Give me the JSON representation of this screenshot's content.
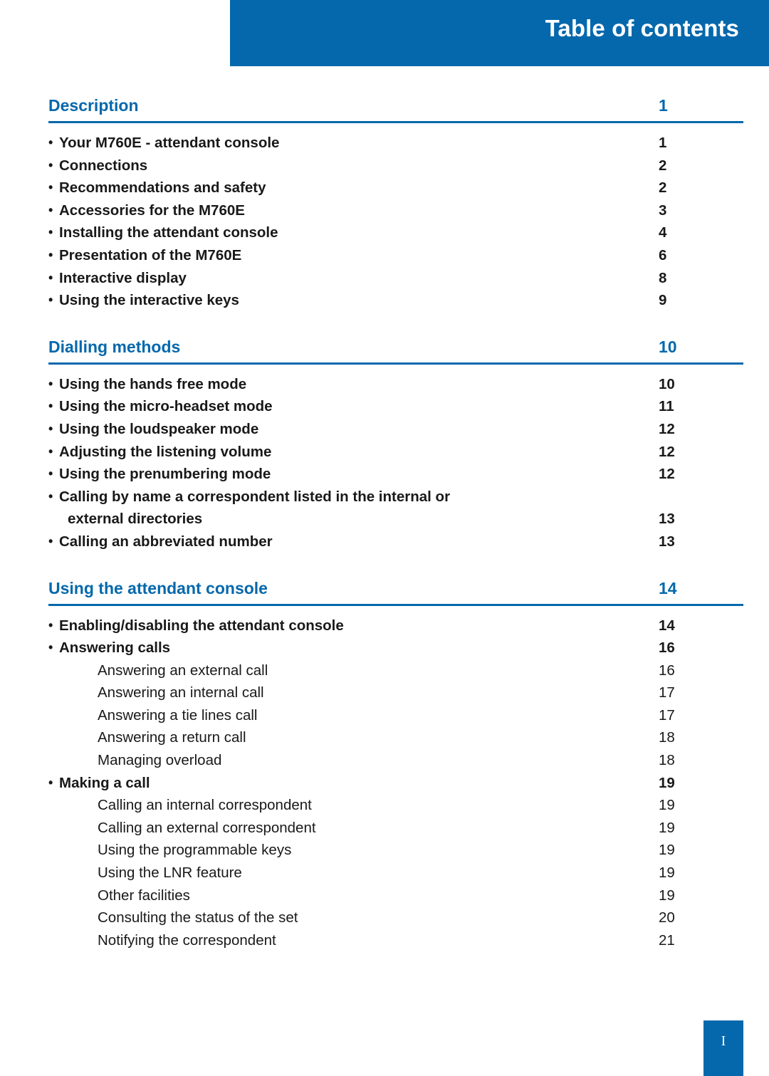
{
  "header": {
    "title": "Table of contents",
    "bar_color": "#0568ac"
  },
  "footer": {
    "page_marker": "I"
  },
  "sections": [
    {
      "title": "Description",
      "page": "1",
      "entries": [
        {
          "level": 1,
          "label": "Your M760E - attendant console",
          "page": "1"
        },
        {
          "level": 1,
          "label": "Connections",
          "page": "2"
        },
        {
          "level": 1,
          "label": "Recommendations and safety",
          "page": "2"
        },
        {
          "level": 1,
          "label": "Accessories for the M760E",
          "page": "3"
        },
        {
          "level": 1,
          "label": "Installing the attendant console",
          "page": "4"
        },
        {
          "level": 1,
          "label": "Presentation of the M760E",
          "page": "6"
        },
        {
          "level": 1,
          "label": "Interactive display",
          "page": "8"
        },
        {
          "level": 1,
          "label": "Using the interactive keys",
          "page": "9"
        }
      ]
    },
    {
      "title": "Dialling methods",
      "page": "10",
      "entries": [
        {
          "level": 1,
          "label": "Using the hands free mode",
          "page": "10"
        },
        {
          "level": 1,
          "label": "Using the micro-headset mode",
          "page": "11"
        },
        {
          "level": 1,
          "label": "Using the loudspeaker mode",
          "page": "12"
        },
        {
          "level": 1,
          "label": "Adjusting the listening volume",
          "page": "12"
        },
        {
          "level": 1,
          "label": "Using the prenumbering mode",
          "page": "12"
        },
        {
          "level": 1,
          "label": "Calling by name a correspondent listed in the internal or",
          "page": ""
        },
        {
          "level": "1cont",
          "label": "external directories",
          "page": "13"
        },
        {
          "level": 1,
          "label": "Calling an abbreviated number",
          "page": "13"
        }
      ]
    },
    {
      "title": "Using the attendant console",
      "page": "14",
      "entries": [
        {
          "level": 1,
          "label": "Enabling/disabling the attendant console",
          "page": "14"
        },
        {
          "level": 1,
          "label": "Answering calls",
          "page": "16"
        },
        {
          "level": 2,
          "label": "Answering an external call",
          "page": "16"
        },
        {
          "level": 2,
          "label": "Answering an internal call",
          "page": "17"
        },
        {
          "level": 2,
          "label": "Answering a tie lines call",
          "page": "17"
        },
        {
          "level": 2,
          "label": "Answering a return call",
          "page": "18"
        },
        {
          "level": 2,
          "label": "Managing overload",
          "page": "18"
        },
        {
          "level": 1,
          "label": "Making a call",
          "page": "19"
        },
        {
          "level": 2,
          "label": "Calling an internal correspondent",
          "page": "19"
        },
        {
          "level": 2,
          "label": "Calling an external correspondent",
          "page": "19"
        },
        {
          "level": 2,
          "label": "Using the programmable keys",
          "page": "19"
        },
        {
          "level": 2,
          "label": "Using the LNR feature",
          "page": "19"
        },
        {
          "level": 2,
          "label": "Other facilities",
          "page": "19"
        },
        {
          "level": 2,
          "label": "Consulting the status of the set",
          "page": "20"
        },
        {
          "level": 2,
          "label": "Notifying the correspondent",
          "page": "21"
        }
      ]
    }
  ]
}
